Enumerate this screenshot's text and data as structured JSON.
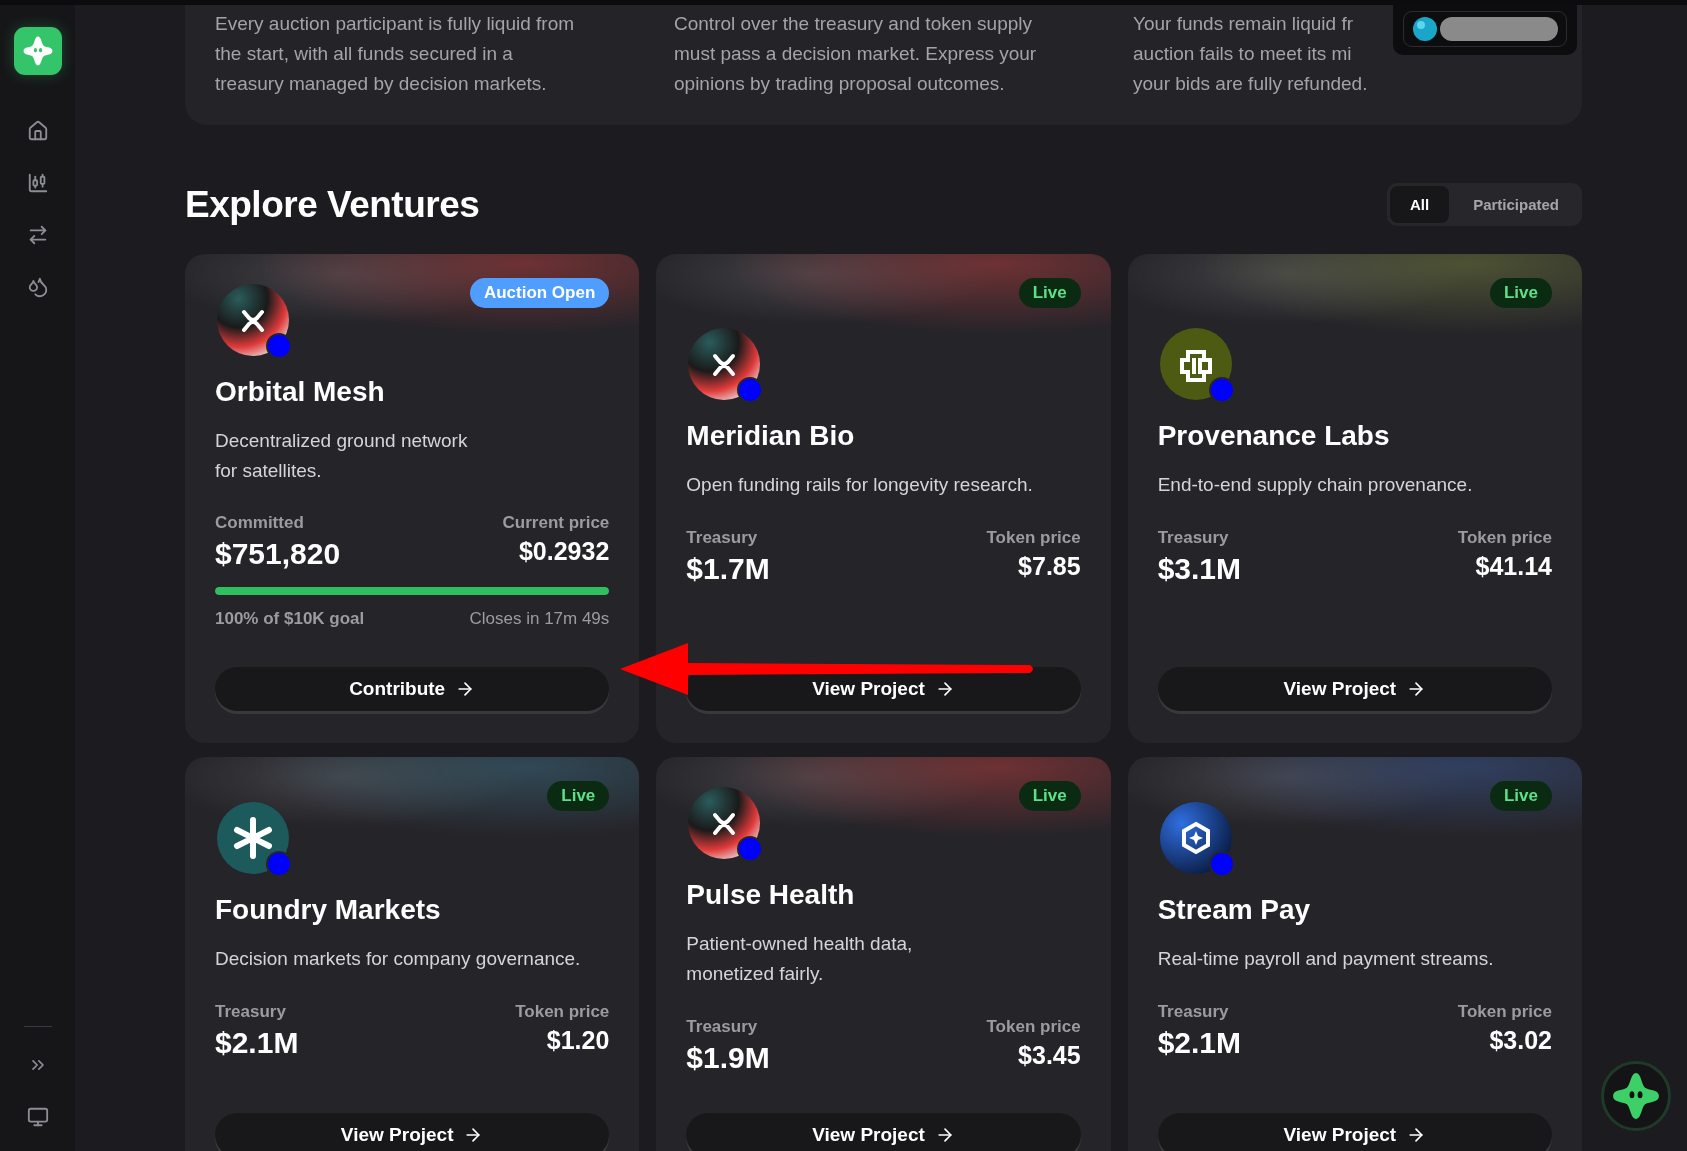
{
  "intro_panel": {
    "columns": [
      {
        "lines": [
          "Every auction participant is fully liquid from",
          "the start, with all funds secured in a",
          "treasury managed by decision markets."
        ]
      },
      {
        "lines": [
          "Control over the treasury and token supply",
          "must pass a decision market. Express your",
          "opinions by trading proposal outcomes."
        ]
      },
      {
        "lines": [
          "Your funds remain liquid fr",
          "auction fails to meet its mi",
          "your bids are fully refunded."
        ]
      }
    ]
  },
  "section": {
    "title": "Explore Ventures"
  },
  "filter_tabs": [
    {
      "label": "All",
      "selected": true
    },
    {
      "label": "Participated",
      "selected": false
    }
  ],
  "ventures": [
    {
      "kind": "orbit",
      "name": "Orbital Mesh",
      "description": "Decentralized ground network\nfor satellites.",
      "status": {
        "kind": "auction",
        "label": "Auction Open"
      },
      "stats": [
        {
          "label": "Committed",
          "value": "$751,820"
        },
        {
          "label": "Current price",
          "value": "$0.2932"
        }
      ],
      "progress": {
        "level": 1,
        "goal": "100% of $10K goal",
        "closes": "Closes in 17m 49s"
      },
      "button": "Contribute"
    },
    {
      "kind": "orbit",
      "name": "Meridian Bio",
      "description": "Open funding rails for longevity research.",
      "status": {
        "kind": "live",
        "label": "Live"
      },
      "stats": [
        {
          "label": "Treasury",
          "value": "$1.7M"
        },
        {
          "label": "Token price",
          "value": "$7.85"
        }
      ],
      "button": "View Project"
    },
    {
      "kind": "cells",
      "name": "Provenance Labs",
      "description": "End-to-end supply chain provenance.",
      "status": {
        "kind": "live",
        "label": "Live"
      },
      "stats": [
        {
          "label": "Treasury",
          "value": "$3.1M"
        },
        {
          "label": "Token price",
          "value": "$41.14"
        }
      ],
      "button": "View Project"
    },
    {
      "kind": "asterisk",
      "name": "Foundry Markets",
      "description": "Decision markets for company governance.",
      "status": {
        "kind": "live",
        "label": "Live"
      },
      "stats": [
        {
          "label": "Treasury",
          "value": "$2.1M"
        },
        {
          "label": "Token price",
          "value": "$1.20"
        }
      ],
      "button": "View Project"
    },
    {
      "kind": "orbit",
      "name": "Pulse Health",
      "description": "Patient-owned health data,\nmonetized fairly.",
      "status": {
        "kind": "live",
        "label": "Live"
      },
      "stats": [
        {
          "label": "Treasury",
          "value": "$1.9M"
        },
        {
          "label": "Token price",
          "value": "$3.45"
        }
      ],
      "button": "View Project"
    },
    {
      "kind": "hex",
      "name": "Stream Pay",
      "description": "Real-time payroll and payment streams.",
      "status": {
        "kind": "live",
        "label": "Live"
      },
      "stats": [
        {
          "label": "Treasury",
          "value": "$2.1M"
        },
        {
          "label": "Token price",
          "value": "$3.02"
        }
      ],
      "button": "View Project"
    }
  ],
  "annotation_arrow": true
}
